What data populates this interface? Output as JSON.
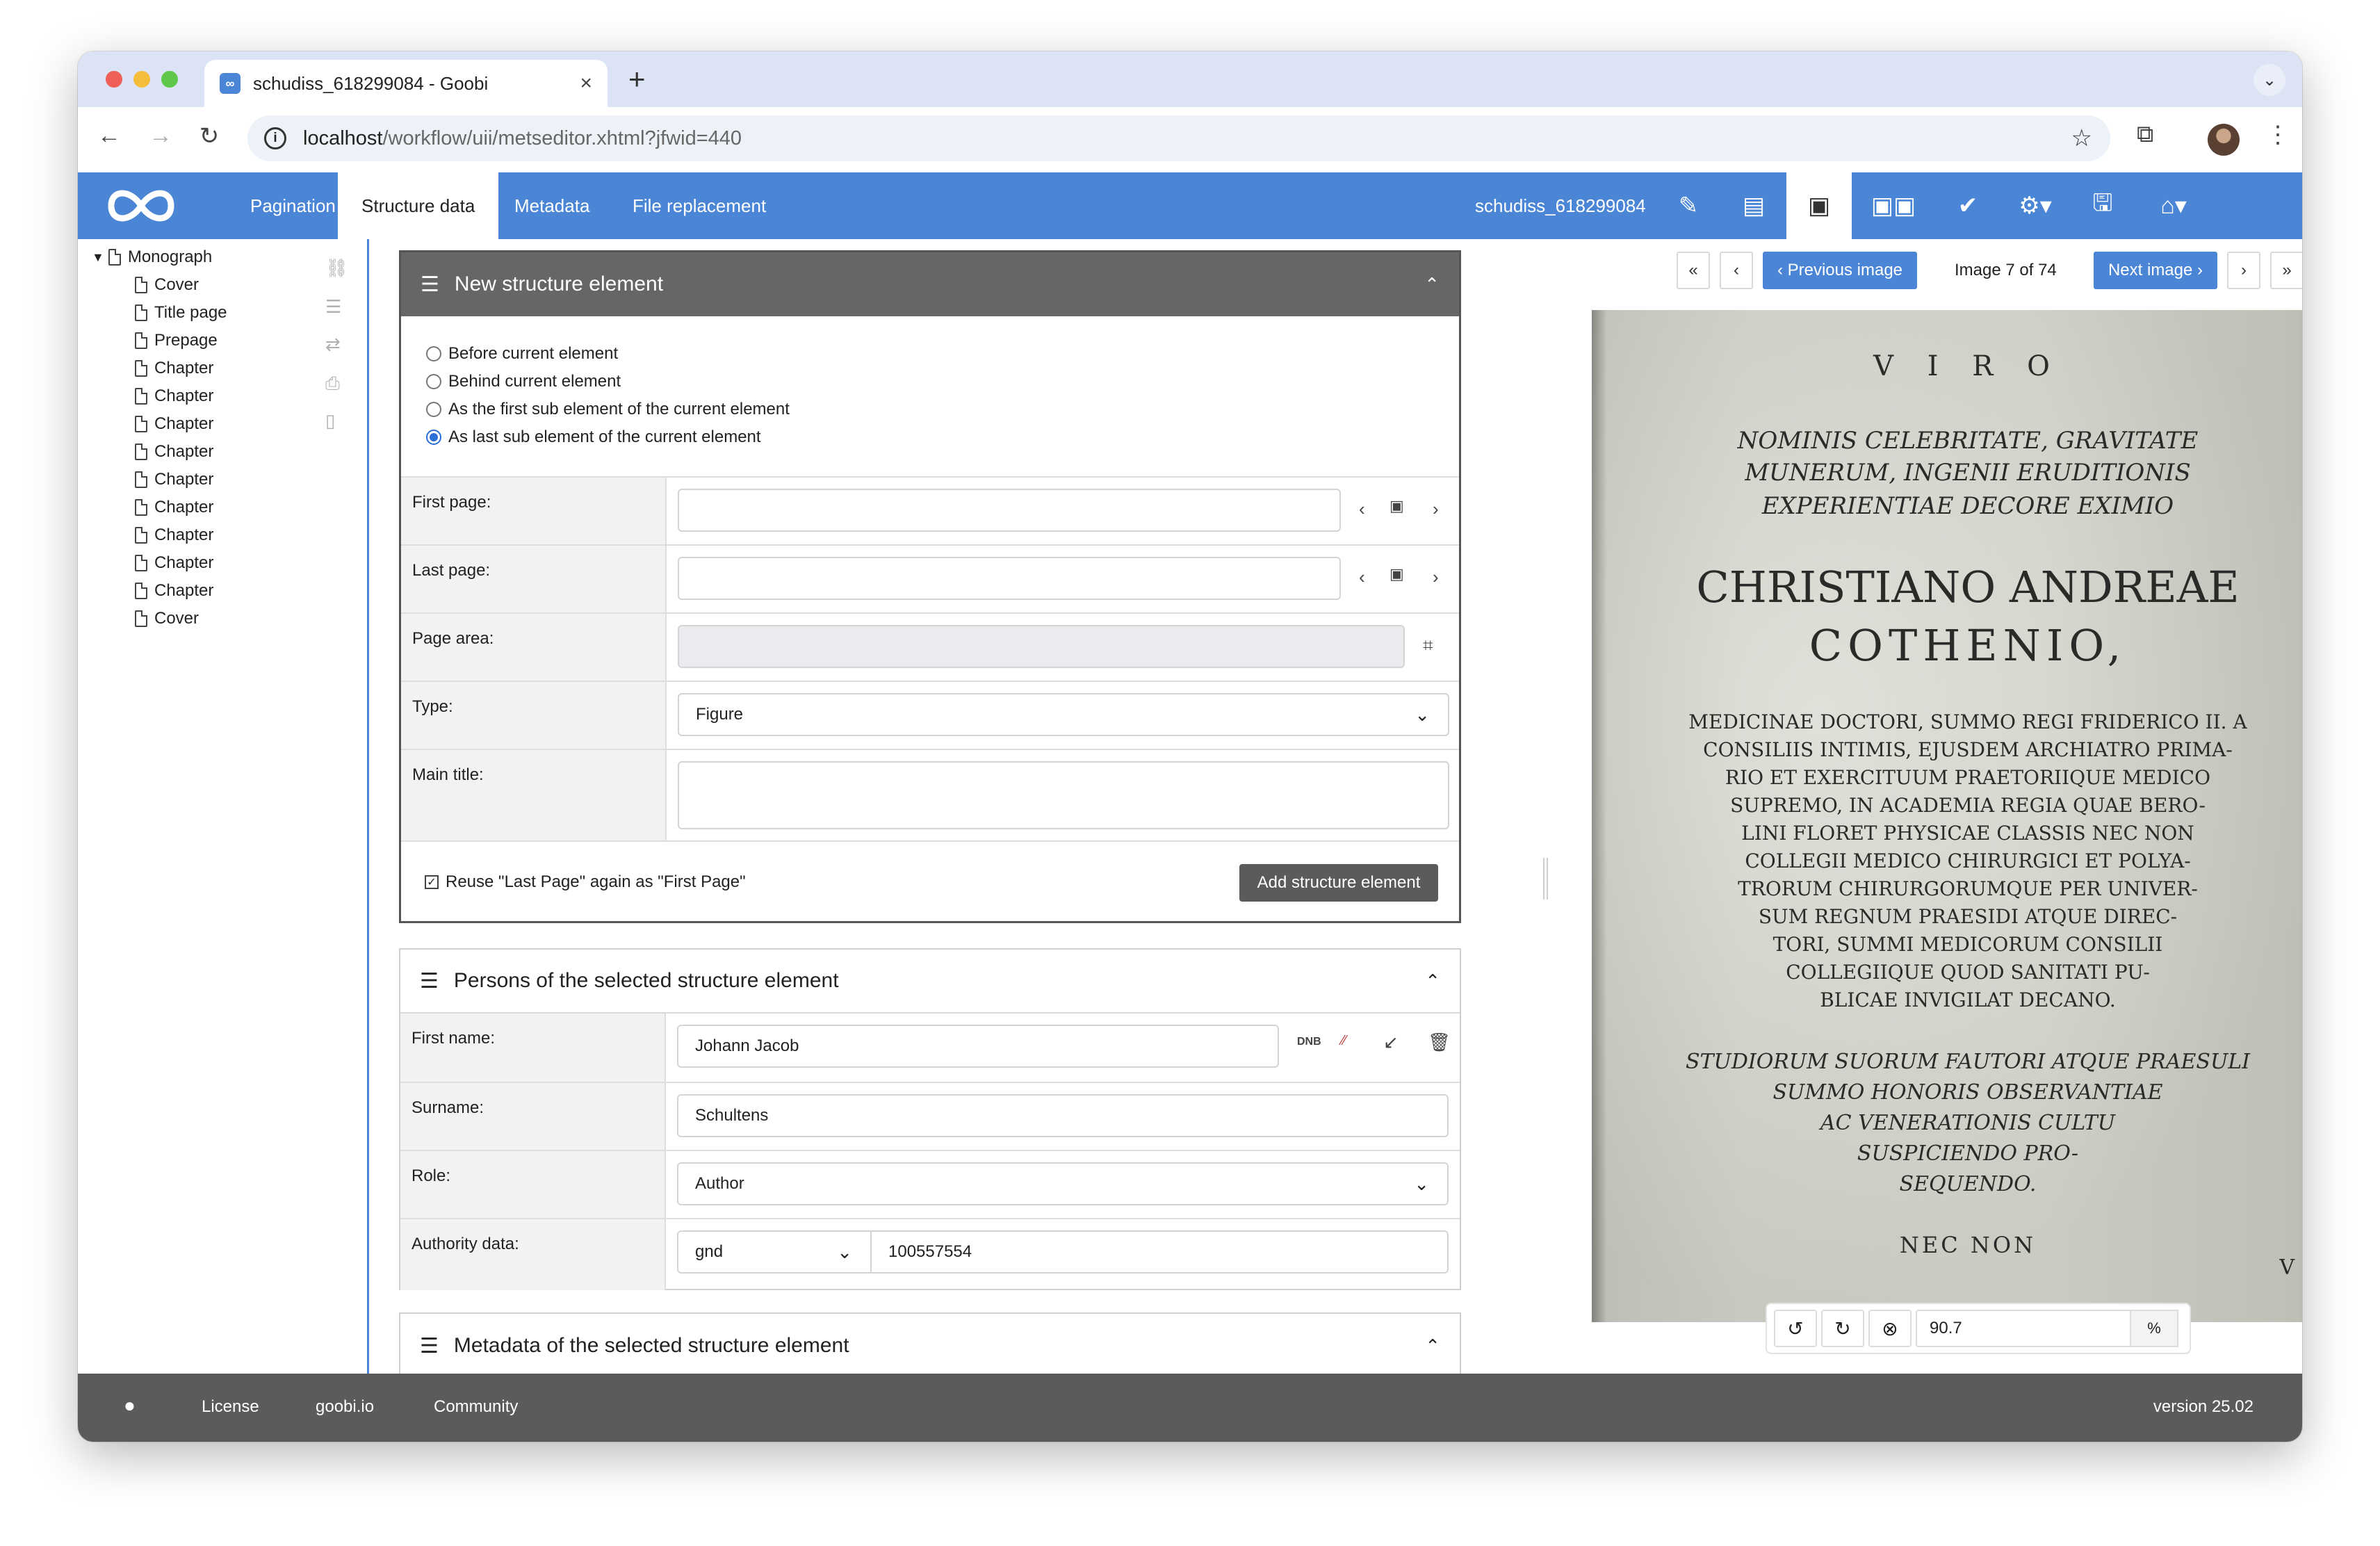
{
  "browser": {
    "tab_title": "schudiss_618299084 - Goobi",
    "url_host": "localhost",
    "url_path": "/workflow/uii/metseditor.xhtml?jfwid=440"
  },
  "app": {
    "nav_tabs": [
      "Pagination",
      "Structure data",
      "Metadata",
      "File replacement"
    ],
    "process_title": "schudiss_618299084",
    "brand_color": "#4a85d6"
  },
  "tree": {
    "root": "Monograph",
    "items": [
      "Cover",
      "Title page",
      "Prepage",
      "Chapter",
      "Chapter",
      "Chapter",
      "Chapter",
      "Chapter",
      "Chapter",
      "Chapter",
      "Chapter",
      "Chapter",
      "Cover"
    ]
  },
  "new_element": {
    "title": "New structure element",
    "options": [
      "Before current element",
      "Behind current element",
      "As the first sub element of the current element",
      "As last sub element of the current element"
    ],
    "selected_option": 3,
    "first_page_label": "First page:",
    "first_page_value": "",
    "last_page_label": "Last page:",
    "last_page_value": "",
    "page_area_label": "Page area:",
    "type_label": "Type:",
    "type_value": "Figure",
    "main_title_label": "Main title:",
    "main_title_value": "",
    "reuse_label": "Reuse \"Last Page\" again as \"First Page\"",
    "add_button": "Add structure element"
  },
  "persons": {
    "title": "Persons of the selected structure element",
    "first_name_label": "First name:",
    "first_name": "Johann Jacob",
    "surname_label": "Surname:",
    "surname": "Schultens",
    "role_label": "Role:",
    "role": "Author",
    "authority_label": "Authority data:",
    "authority_type": "gnd",
    "authority_id": "100557554"
  },
  "metadata_panel": {
    "title": "Metadata of the selected structure element"
  },
  "viewer": {
    "first": "«",
    "prev_small": "‹",
    "prev_label": "‹ Previous image",
    "counter": "Image 7 of 74",
    "next_label": "Next image ›",
    "next_small": "›",
    "last": "»",
    "zoom": "90.7",
    "zoom_unit": "%",
    "scan_lines": [
      "V I R O",
      "NOMINIS CELEBRITATE, GRAVITATE",
      "MUNERUM, INGENII ERUDITIONIS",
      "EXPERIENTIAE DECORE EXIMIO",
      "CHRISTIANO ANDREAE",
      "COTHENIO,",
      "MEDICINAE DOCTORI, SUMMO REGI FRIDERICO II. A",
      "CONSILIIS INTIMIS, EJUSDEM ARCHIATRO PRIMA-",
      "RIO ET EXERCITUUM PRAETORIIQUE MEDICO",
      "SUPREMO, IN ACADEMIA REGIA QUAE BERO-",
      "LINI FLORET PHYSICAE CLASSIS NEC NON",
      "COLLEGII MEDICO CHIRURGICI ET POLYA-",
      "TRORUM CHIRURGORUMQUE PER UNIVER-",
      "SUM REGNUM PRAESIDI ATQUE DIREC-",
      "TORI, SUMMI MEDICORUM CONSILII",
      "COLLEGIIQUE QUOD SANITATI PU-",
      "BLICAE INVIGILAT DECANO.",
      "STUDIORUM SUORUM FAUTORI ATQUE PRAESULI",
      "SUMMO HONORIS OBSERVANTIAE",
      "AC VENERATIONIS CULTU",
      "SUSPICIENDO PRO-",
      "SEQUENDO.",
      "NEC NON",
      "V I."
    ]
  },
  "footer": {
    "links": [
      "License",
      "goobi.io",
      "Community"
    ],
    "version": "version 25.02"
  }
}
